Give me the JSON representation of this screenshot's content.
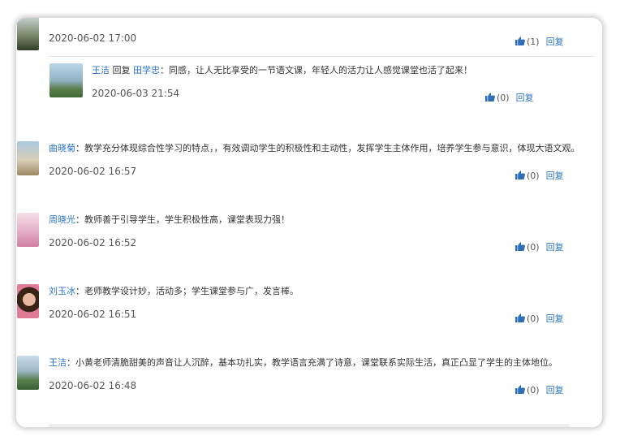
{
  "comments": [
    {
      "date": "2020-06-02 17:00",
      "likes": "(1)",
      "reply_label": "回复"
    },
    {
      "is_reply": true,
      "user": "王洁",
      "reply_word": "回复",
      "target": "田学忠",
      "text": "：同感，让人无比享受的一节语文课，年轻人的活力让人感觉课堂也活了起来！",
      "date": "2020-06-03 21:54",
      "likes": "(0)",
      "reply_label": "回复"
    },
    {
      "user": "曲晓菊",
      "text": "：教学充分体现综合性学习的特点，，有效调动学生的积极性和主动性，发挥学生主体作用，培养学生参与意识，体现大语文观。",
      "date": "2020-06-02 16:57",
      "likes": "(0)",
      "reply_label": "回复"
    },
    {
      "user": "周晓光",
      "text": "：教师善于引导学生，学生积极性高，课堂表现力强！",
      "date": "2020-06-02 16:52",
      "likes": "(0)",
      "reply_label": "回复"
    },
    {
      "user": "刘玉冰",
      "text": "：老师教学设计妙，活动多；学生课堂参与广，发言棒。",
      "date": "2020-06-02 16:51",
      "likes": "(0)",
      "reply_label": "回复"
    },
    {
      "user": "王洁",
      "text": "：小黄老师清脆甜美的声音让人沉醉，基本功扎实，教学语言充满了诗意，课堂联系实际生活，真正凸显了学生的主体地位。",
      "date": "2020-06-02 16:48",
      "likes": "(0)",
      "reply_label": "回复"
    }
  ],
  "icons": {
    "like": "thumbs-up-icon"
  },
  "colors": {
    "link": "#2a76c7",
    "like_icon": "#2e6fb8"
  }
}
